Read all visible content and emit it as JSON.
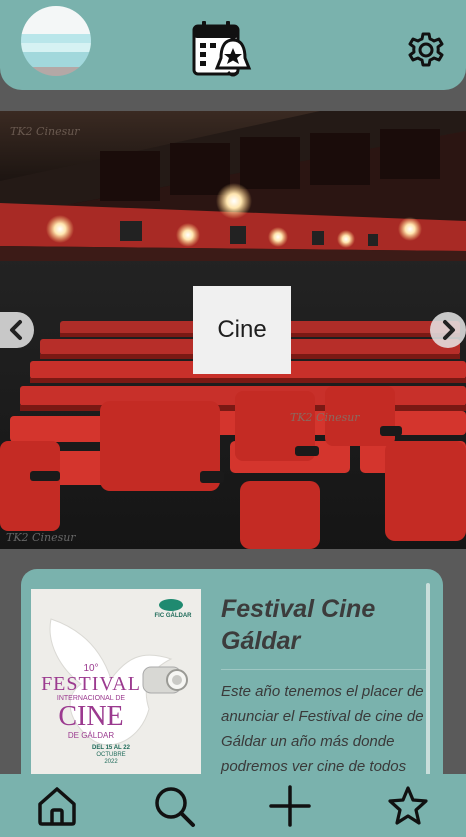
{
  "header": {
    "avatar": "profile-avatar",
    "center_icon": "calendar-bell-icon",
    "settings_icon": "gear-icon"
  },
  "carousel": {
    "label": "Cine",
    "image_watermarks": [
      "TK2 Cinesur",
      "TK2 Cinesur",
      "TK2 Cinesur"
    ],
    "prev_icon": "chevron-left-icon",
    "next_icon": "chevron-right-icon"
  },
  "card": {
    "title": "Festival Cine Gáldar",
    "text": "Este año tenemos el placer de anunciar el Festival de cine de Gáldar un año más donde podremos ver cine de todos",
    "poster": {
      "edition": "10°",
      "line1": "FESTIVAL",
      "line2": "INTERNACIONAL DE",
      "line3": "CINE",
      "line4": "DE GÁLDAR",
      "dates": "DEL 15 AL 22",
      "month": "OCTUBRE",
      "year": "2022",
      "logo_text": "FIC GÁLDAR"
    }
  },
  "tabbar": {
    "items": [
      "home-icon",
      "search-icon",
      "add-icon",
      "star-icon"
    ]
  },
  "colors": {
    "accent": "#7ab2ad",
    "background": "#5a5a5a"
  }
}
